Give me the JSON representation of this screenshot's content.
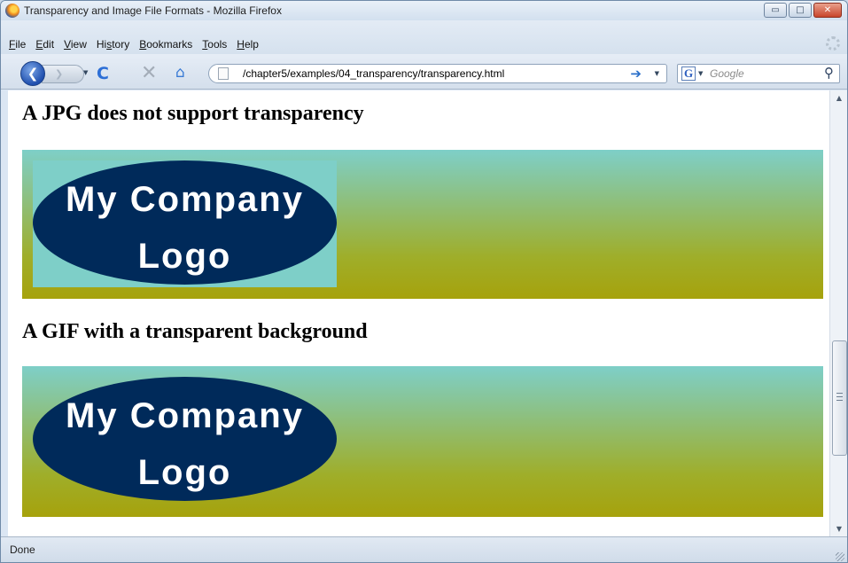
{
  "window": {
    "title": "Transparency and Image File Formats - Mozilla Firefox",
    "controls": {
      "minimize": "▭",
      "maximize": "□",
      "close": "✕"
    }
  },
  "menu": [
    {
      "accel": "F",
      "rest": "ile"
    },
    {
      "accel": "E",
      "rest": "dit"
    },
    {
      "accel": "V",
      "rest": "iew"
    },
    {
      "pre": "Hi",
      "accel": "s",
      "rest": "tory"
    },
    {
      "accel": "B",
      "rest": "ookmarks"
    },
    {
      "accel": "T",
      "rest": "ools"
    },
    {
      "accel": "H",
      "rest": "elp"
    }
  ],
  "nav": {
    "back_icon": "❮",
    "forward_icon": "❯",
    "reload_icon": "C",
    "stop_icon": "✕",
    "home_icon": "⌂",
    "dropdown_icon": "▼",
    "go_icon": "➔"
  },
  "urlbar": {
    "url": "/chapter5/examples/04_transparency/transparency.html"
  },
  "search": {
    "engine_letter": "G",
    "placeholder": "Google",
    "icon": "⚲"
  },
  "content": {
    "heading1": "A JPG does not support transparency",
    "heading2": "A GIF with a transparent background",
    "logo1": {
      "line1": "My Company",
      "line2": "Logo"
    },
    "logo2": {
      "line1": "My Company",
      "line2": "Logo"
    }
  },
  "colors": {
    "gradient_top": "#7ecfc8",
    "gradient_bottom": "#a6a20c",
    "logo_fill": "#002a5a",
    "logo_text": "#ffffff"
  },
  "scrollbar": {
    "up": "▲",
    "down": "▼"
  },
  "status": {
    "text": "Done"
  }
}
